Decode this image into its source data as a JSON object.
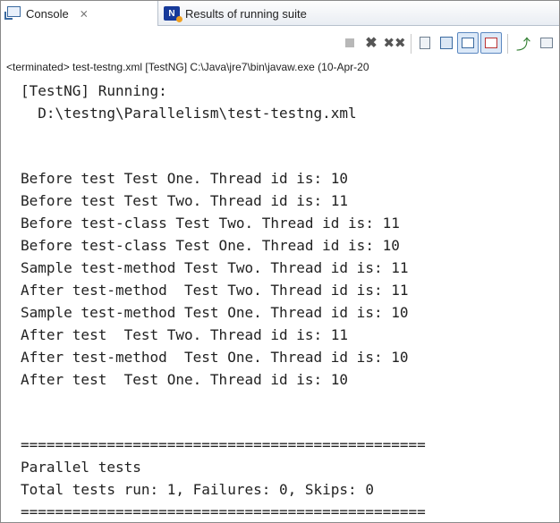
{
  "tabs": [
    {
      "label": "Console",
      "icon": "console-icon",
      "close": "⨯"
    },
    {
      "label": "Results of running suite",
      "icon": "testng-icon"
    }
  ],
  "toolbar": {
    "buttons": [
      "terminate-icon",
      "remove-launch-icon",
      "remove-all-terminated-icon",
      "scroll-lock-icon",
      "word-wrap-icon",
      "show-console-on-stdout-icon",
      "show-console-on-stderr-icon",
      "pin-console-icon",
      "open-console-icon"
    ]
  },
  "status": "<terminated> test-testng.xml [TestNG] C:\\Java\\jre7\\bin\\javaw.exe (10-Apr-20",
  "output": {
    "lines": [
      "[TestNG] Running:",
      "  D:\\testng\\Parallelism\\test-testng.xml",
      "",
      "Before test Test One. Thread id is: 10",
      "Before test Test Two. Thread id is: 11",
      "Before test-class Test Two. Thread id is: 11",
      "Before test-class Test One. Thread id is: 10",
      "Sample test-method Test Two. Thread id is: 11",
      "After test-method  Test Two. Thread id is: 11",
      "Sample test-method Test One. Thread id is: 10",
      "After test  Test Two. Thread id is: 11",
      "After test-method  Test One. Thread id is: 10",
      "After test  Test One. Thread id is: 10",
      "",
      "",
      "===============================================",
      "Parallel tests",
      "Total tests run: 1, Failures: 0, Skips: 0",
      "==============================================="
    ]
  },
  "colors": {
    "text": "#222222",
    "tab_border": "#b7c0cc",
    "toggle_bg": "#dce9f8"
  }
}
